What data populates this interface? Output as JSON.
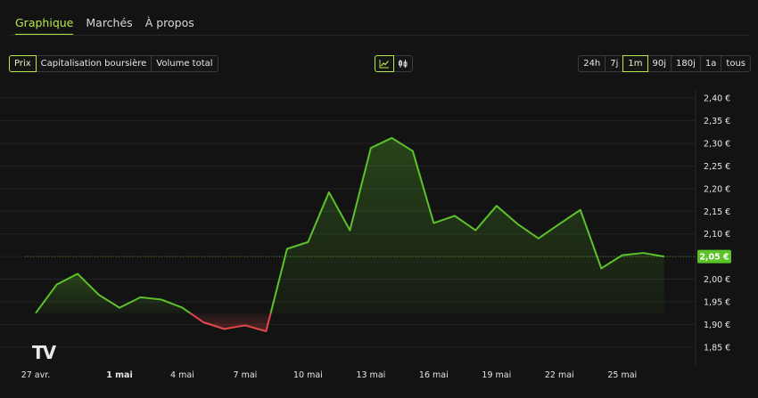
{
  "tabs": [
    {
      "label": "Graphique",
      "active": true
    },
    {
      "label": "Marchés",
      "active": false
    },
    {
      "label": "À propos",
      "active": false
    }
  ],
  "metric_buttons": [
    {
      "label": "Prix",
      "active": true
    },
    {
      "label": "Capitalisation boursière",
      "active": false
    },
    {
      "label": "Volume total",
      "active": false
    }
  ],
  "chart_type_buttons": [
    {
      "icon": "line-chart-icon",
      "active": true
    },
    {
      "icon": "candlestick-chart-icon",
      "active": false
    }
  ],
  "range_buttons": [
    {
      "label": "24h",
      "active": false
    },
    {
      "label": "7j",
      "active": false
    },
    {
      "label": "1m",
      "active": true
    },
    {
      "label": "90j",
      "active": false
    },
    {
      "label": "180j",
      "active": false
    },
    {
      "label": "1a",
      "active": false
    },
    {
      "label": "tous",
      "active": false
    }
  ],
  "watermark": "TV",
  "colors": {
    "accent": "#b6e84a",
    "up": "#5cc22a",
    "down": "#e5484d",
    "background": "#131313"
  },
  "chart_data": {
    "type": "line",
    "title": "",
    "xlabel": "",
    "ylabel": "",
    "y_unit": "€",
    "baseline": 1.925,
    "ylim": [
      1.83,
      2.42
    ],
    "xlim": [
      0,
      31.5
    ],
    "y_ticks": [
      "2,40 €",
      "2,35 €",
      "2,30 €",
      "2,25 €",
      "2,20 €",
      "2,15 €",
      "2,10 €",
      "2,05 €",
      "2,00 €",
      "1,95 €",
      "1,90 €",
      "1,85 €"
    ],
    "y_tick_values": [
      2.4,
      2.35,
      2.3,
      2.25,
      2.2,
      2.15,
      2.1,
      2.05,
      2.0,
      1.95,
      1.9,
      1.85
    ],
    "x_ticks": [
      {
        "label": "27 avr.",
        "x": 0,
        "bold": false
      },
      {
        "label": "1 mai",
        "x": 4,
        "bold": true
      },
      {
        "label": "4 mai",
        "x": 7,
        "bold": false
      },
      {
        "label": "7 mai",
        "x": 10,
        "bold": false
      },
      {
        "label": "10 mai",
        "x": 13,
        "bold": false
      },
      {
        "label": "13 mai",
        "x": 16,
        "bold": false
      },
      {
        "label": "16 mai",
        "x": 19,
        "bold": false
      },
      {
        "label": "19 mai",
        "x": 22,
        "bold": false
      },
      {
        "label": "22 mai",
        "x": 25,
        "bold": false
      },
      {
        "label": "25 mai",
        "x": 28,
        "bold": false
      }
    ],
    "x": [
      0,
      1,
      2,
      3,
      4,
      5,
      6,
      7,
      8,
      9,
      10,
      11,
      12,
      13,
      14,
      15,
      16,
      17,
      18,
      19,
      20,
      21,
      22,
      23,
      24,
      25,
      26,
      27,
      28,
      29,
      30
    ],
    "values": [
      1.925,
      1.988,
      2.012,
      1.966,
      1.937,
      1.96,
      1.955,
      1.937,
      1.905,
      1.89,
      1.898,
      1.885,
      2.067,
      2.082,
      2.192,
      2.108,
      2.29,
      2.312,
      2.283,
      2.124,
      2.14,
      2.108,
      2.162,
      2.122,
      2.09,
      2.122,
      2.153,
      2.024,
      2.053,
      2.058,
      2.05
    ],
    "current_price": 2.05,
    "current_price_label": "2,05 €"
  }
}
